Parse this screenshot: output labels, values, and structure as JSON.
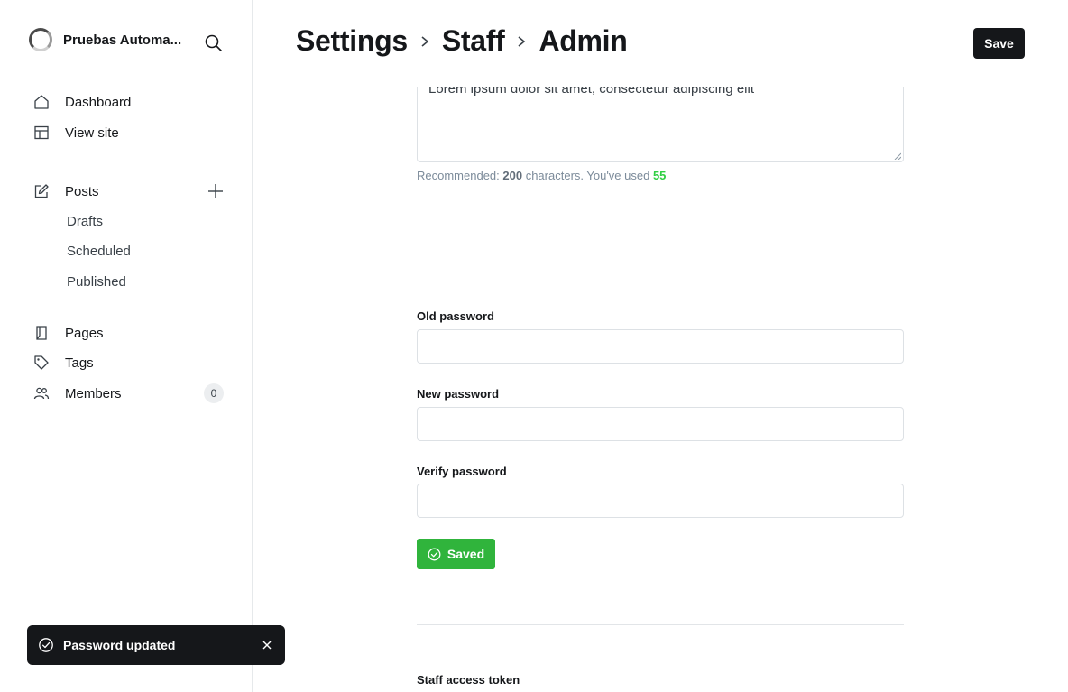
{
  "sidebar": {
    "site_name": "Pruebas Automa...",
    "nav": [
      {
        "label": "Dashboard",
        "icon": "home-icon"
      },
      {
        "label": "View site",
        "icon": "layout-icon"
      }
    ],
    "posts": {
      "label": "Posts",
      "icon": "edit-icon",
      "subitems": [
        "Drafts",
        "Scheduled",
        "Published"
      ]
    },
    "secondary": [
      {
        "label": "Pages",
        "icon": "pages-icon"
      },
      {
        "label": "Tags",
        "icon": "tag-icon"
      },
      {
        "label": "Members",
        "icon": "members-icon",
        "count": "0"
      }
    ]
  },
  "header": {
    "breadcrumb": [
      "Settings",
      "Staff",
      "Admin"
    ],
    "save_label": "Save"
  },
  "bio": {
    "value": "Lorem ipsum dolor sit amet, consectetur adipiscing elit",
    "hint_prefix": "Recommended: ",
    "hint_limit": "200",
    "hint_middle": " characters. You've used ",
    "hint_used": "55"
  },
  "password": {
    "old_label": "Old password",
    "new_label": "New password",
    "verify_label": "Verify password",
    "saved_label": "Saved"
  },
  "token": {
    "label": "Staff access token"
  },
  "toast": {
    "message": "Password updated"
  },
  "colors": {
    "accent_green": "#30b43c",
    "dark": "#15171a"
  }
}
